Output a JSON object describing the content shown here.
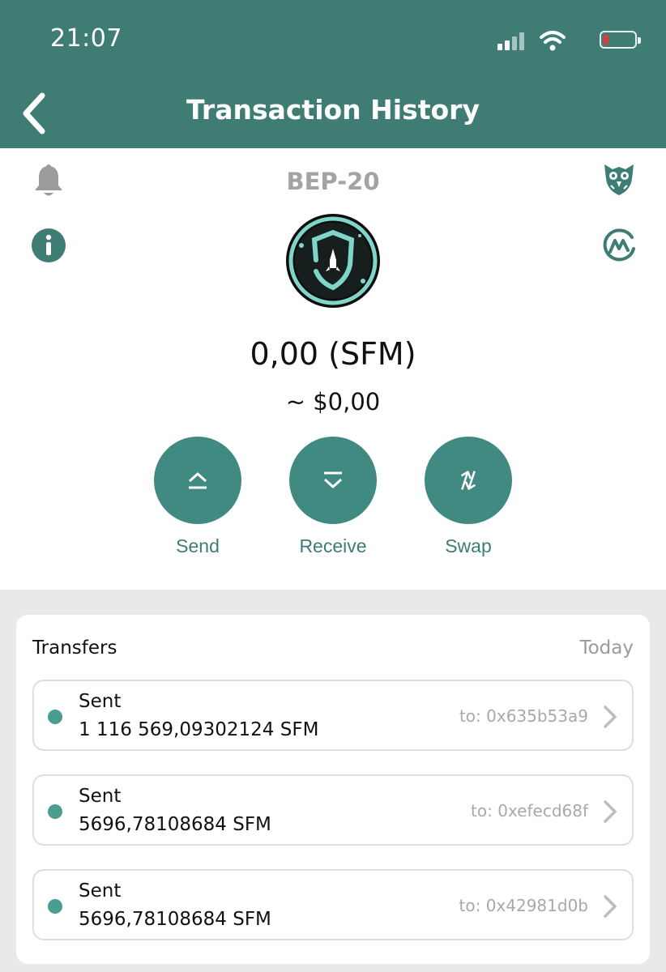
{
  "status_bar": {
    "time": "21:07"
  },
  "header": {
    "title": "Transaction History"
  },
  "token": {
    "network": "BEP-20",
    "balance": "0,00 (SFM)",
    "fiat_value": "~ $0,00"
  },
  "actions": [
    {
      "label": "Send"
    },
    {
      "label": "Receive"
    },
    {
      "label": "Swap"
    }
  ],
  "transfers": {
    "title": "Transfers",
    "date": "Today",
    "items": [
      {
        "type": "Sent",
        "amount": "1 116 569,09302124 SFM",
        "to": "to: 0x635b53a9"
      },
      {
        "type": "Sent",
        "amount": "5696,78108684 SFM",
        "to": "to: 0xefecd68f"
      },
      {
        "type": "Sent",
        "amount": "5696,78108684 SFM",
        "to": "to: 0x42981d0b"
      }
    ]
  },
  "colors": {
    "header": "#3f7d74",
    "accent": "#418a81",
    "battery_low": "#e53935"
  },
  "icons": [
    "back-chevron-icon",
    "bell-icon",
    "info-icon",
    "owl-icon",
    "coinmarketcap-icon",
    "safemoon-logo",
    "send-icon",
    "receive-icon",
    "swap-icon",
    "chevron-right-icon"
  ]
}
